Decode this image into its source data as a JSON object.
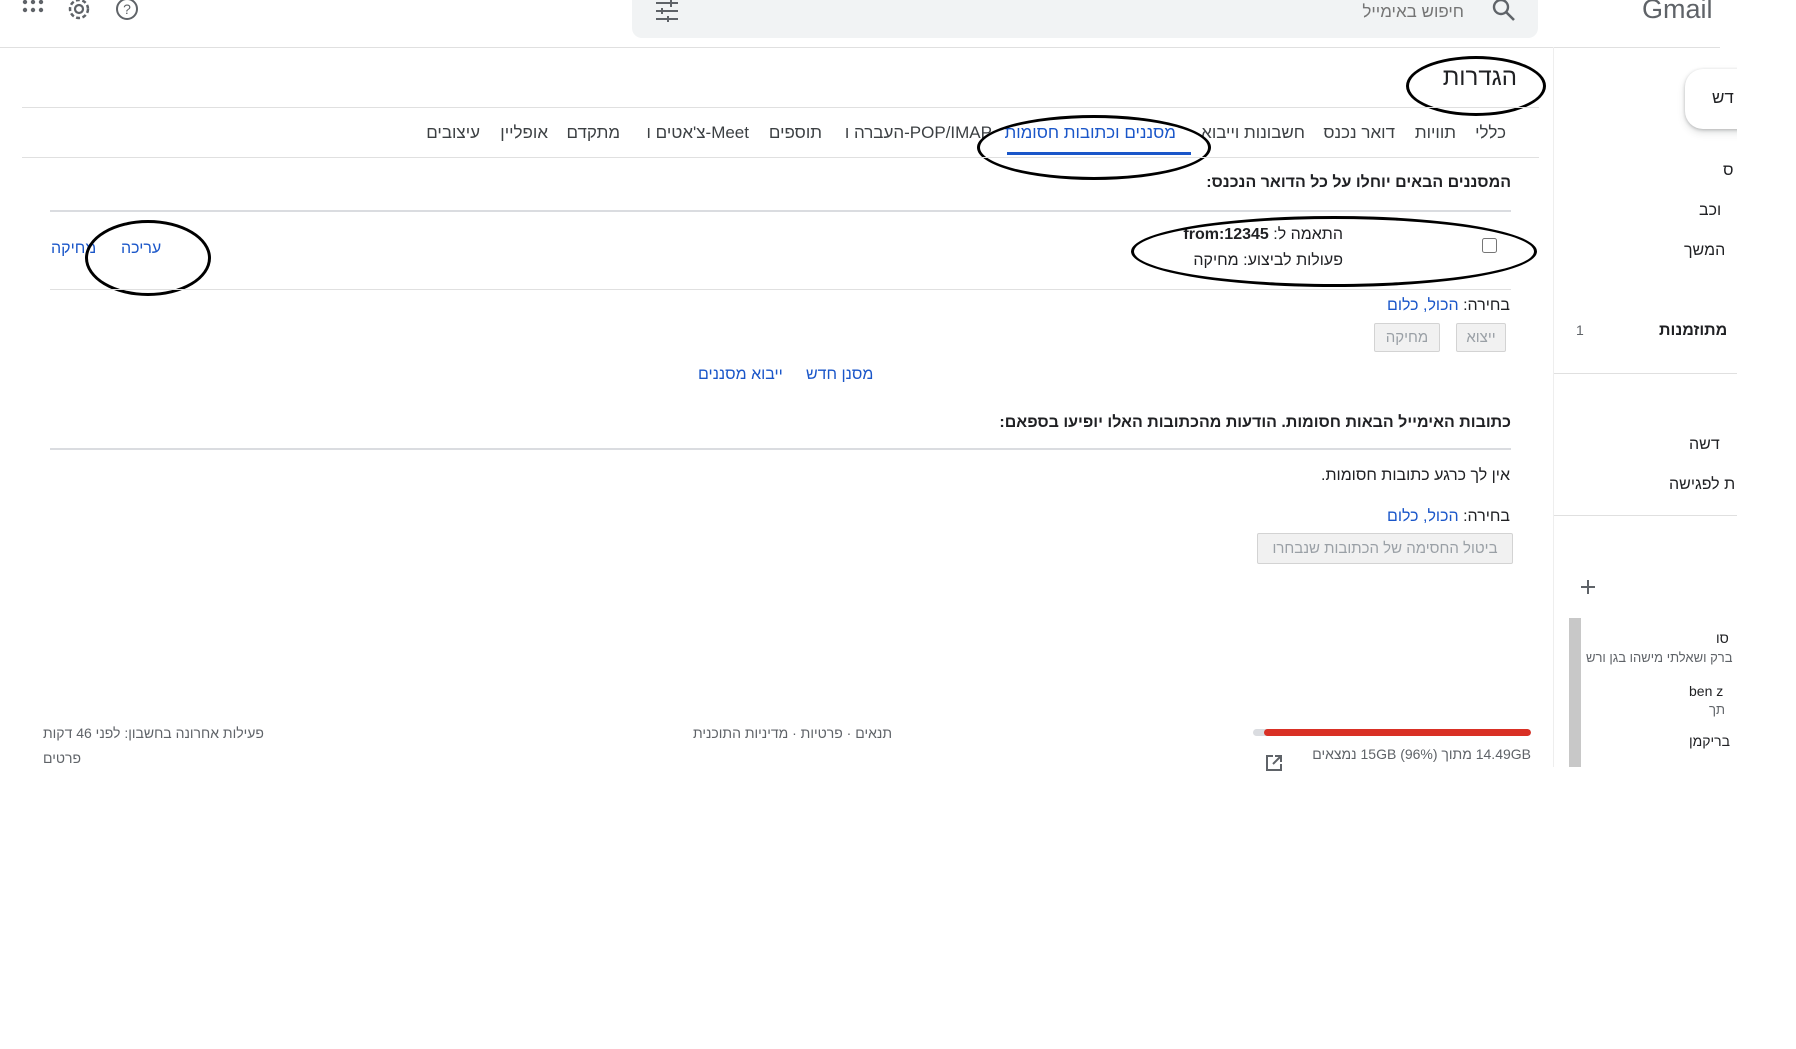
{
  "app": {
    "logo": "Gmail",
    "search_placeholder": "חיפוש באימייל"
  },
  "icons": {
    "apps": "apps-grid-icon",
    "settings": "gear-icon",
    "help": "help-icon",
    "search": "search-icon",
    "filter": "tune-icon",
    "external": "open-in-new-icon",
    "add": "plus-icon"
  },
  "settings": {
    "title": "הגדרות",
    "tabs": [
      "כללי",
      "תוויות",
      "דואר נכנס",
      "חשבונות וייבוא",
      "מסננים וכתובות חסומות",
      "העברה ו-POP/IMAP",
      "תוספים",
      "צ'אטים ו-Meet",
      "מתקדם",
      "אופליין",
      "עיצובים"
    ],
    "active_tab": "מסננים וכתובות חסומות"
  },
  "filters": {
    "heading": "המסננים הבאים יוחלו על כל הדואר הנכנס:",
    "item": {
      "match_label": "התאמה ל:",
      "match_value": "from:12345",
      "actions_label": "פעולות לביצוע:",
      "actions_value": "מחיקה",
      "edit": "עריכה",
      "delete": "מחיקה"
    },
    "select_label": "בחירה:",
    "select_all_none": "הכול, כלום",
    "export_btn": "ייצוא",
    "delete_btn": "מחיקה",
    "new_filter": "מסנן חדש",
    "import_filters": "ייבוא מסננים"
  },
  "blocked": {
    "heading": "כתובות האימייל הבאות חסומות. הודעות מהכתובות האלו יופיעו בספאם:",
    "empty": "אין לך כרגע כתובות חסומות.",
    "select_label": "בחירה:",
    "select_all_none": "הכול, כלום",
    "unblock_btn": "ביטול החסימה של הכתובות שנבחרו"
  },
  "footer": {
    "storage_used_fraction": 0.96,
    "storage_colors": {
      "used": "#d93025",
      "track": "#dadce0"
    },
    "storage_text": "14.49GB מתוך 15GB (96%) נמצאים",
    "links": "תנאים · פרטיות · מדיניות התוכנית",
    "last_activity": "פעילות אחרונה בחשבון: לפני 46 דקות",
    "details": "פרטים"
  },
  "sidebar": {
    "compose": "דש",
    "items": [
      "ס",
      "וכב",
      "המשך",
      "מתוזמנות",
      "דשה",
      "ת לפגישה"
    ],
    "scheduled_count": "1",
    "chat": [
      "סו",
      "ברק ושאלתי מישהו בגן ורש",
      "ben z",
      "תך",
      "בריקמן"
    ]
  }
}
